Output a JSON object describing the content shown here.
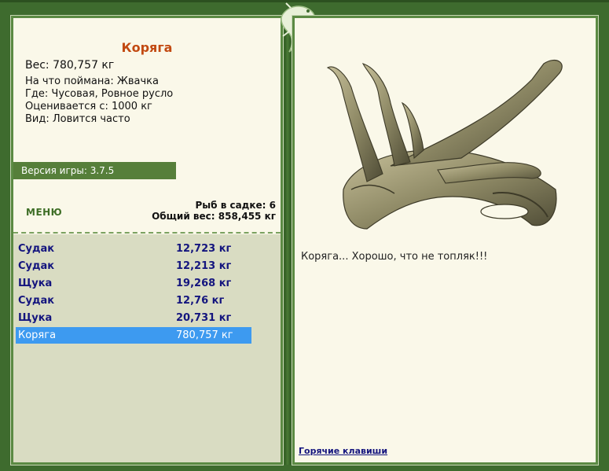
{
  "catch": {
    "title": "Коряга",
    "weight": "Вес: 780,757 кг",
    "bait": "На что поймана: Жвачка",
    "location": "Где: Чусовая, Ровное русло",
    "valued": "Оценивается с: 1000 кг",
    "kind": "Вид: Ловится часто"
  },
  "version": "Версия игры: 3.7.5",
  "menu_label": "МЕНЮ",
  "stats": {
    "fish_count": "Рыб в садке: 6",
    "total_weight": "Общий вес: 858,455 кг"
  },
  "list": [
    {
      "name": "Судак",
      "weight": "12,723 кг"
    },
    {
      "name": "Судак",
      "weight": "12,213 кг"
    },
    {
      "name": "Щука",
      "weight": "19,268 кг"
    },
    {
      "name": "Судак",
      "weight": "12,76 кг"
    },
    {
      "name": "Щука",
      "weight": "20,731 кг"
    },
    {
      "name": "Коряга",
      "weight": "780,757 кг",
      "selected": true
    }
  ],
  "caption": "Коряга... Хорошо, что не топляк!!!",
  "hotkeys": "Горячие клавиши",
  "colors": {
    "frame": "#3e6b2e",
    "panel": "#faf8e9",
    "title": "#c24a12",
    "link": "#14157e",
    "selected": "#3d9af0"
  }
}
